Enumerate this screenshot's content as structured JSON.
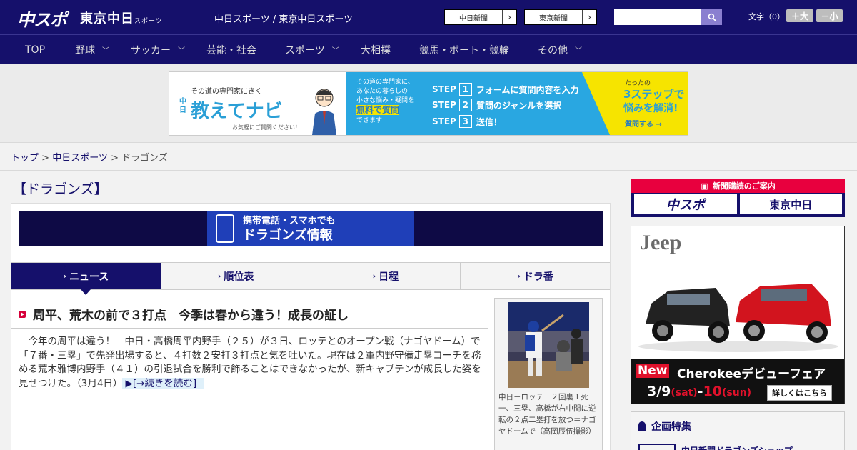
{
  "header": {
    "logo_main": "中スポ",
    "logo_sub": "東京中日",
    "logo_sub_small": "スポーツ",
    "site_title": "中日スポーツ / 東京中日スポーツ",
    "btn_chunichi": "中日新聞",
    "btn_tokyo": "東京新聞",
    "search_placeholder": "",
    "font_label": "文字（0）",
    "font_larger": "＋大",
    "font_smaller": "－小"
  },
  "nav": {
    "items": [
      {
        "label": "TOP",
        "has_menu": false
      },
      {
        "label": "野球",
        "has_menu": true
      },
      {
        "label": "サッカー",
        "has_menu": true
      },
      {
        "label": "芸能・社会",
        "has_menu": false
      },
      {
        "label": "スポーツ",
        "has_menu": true
      },
      {
        "label": "大相撲",
        "has_menu": false
      },
      {
        "label": "競馬・ボート・競輪",
        "has_menu": false
      },
      {
        "label": "その他",
        "has_menu": true
      }
    ]
  },
  "ad_banner": {
    "tagline": "その道の専門家にきく",
    "brand_prefix": "中日",
    "brand": "教えてナビ",
    "note": "お気軽にご質問ください！",
    "mid_text_1": "その道の専門家に、",
    "mid_text_2": "あなたの暮らしの",
    "mid_text_3": "小さな悩み・疑問を",
    "mid_highlight": "無料で質問",
    "mid_text_4": "できます",
    "steps": [
      {
        "num": "1",
        "text": "フォームに質問内容を入力"
      },
      {
        "num": "2",
        "text": "質問のジャンルを選択"
      },
      {
        "num": "3",
        "text": "送信！"
      }
    ],
    "step_label": "STEP",
    "right_small": "たったの",
    "right_big": "3ステップで",
    "right_big2": "悩みを解消!",
    "right_btn": "質問する"
  },
  "breadcrumb": {
    "home": "トップ",
    "sep1": " > ",
    "section": "中日スポーツ",
    "sep2": " > ",
    "current": "ドラゴンズ"
  },
  "page_title": "【ドラゴンズ】",
  "mobile_banner": {
    "line1": "携帯電話・スマホでも",
    "line2": "ドラゴンズ情報"
  },
  "tabs": [
    {
      "label": "ニュース",
      "active": true
    },
    {
      "label": "順位表",
      "active": false
    },
    {
      "label": "日程",
      "active": false
    },
    {
      "label": "ドラ番",
      "active": false
    }
  ],
  "article": {
    "headline": "周平、荒木の前で３打点　今季は春から違う！成長の証し",
    "body": "今年の周平は違う！　中日・高橋周平内野手（２５）が３日、ロッテとのオープン戦（ナゴヤドーム）で「７番・三塁」で先発出場すると、４打数２安打３打点と気を吐いた。現在は２軍内野守備走塁コーチを務める荒木雅博内野手（４１）の引退試合を勝利で飾ることはできなかったが、新キャプテンが成長した姿を見せつけた。（3月4日）",
    "read_more": "[→続きを読む]",
    "photo_caption": "中日－ロッテ　２回裏１死一、三塁、高橋が右中間に逆転の２点二塁打を放つ＝ナゴヤドームで（高岡辰伍撮影）"
  },
  "sidebar": {
    "subscribe_label": "新聞購読のご案内",
    "sub_logo_1": "中スポ",
    "sub_logo_2": "東京中日",
    "jeep_ad": {
      "brand": "Jeep",
      "new": "New",
      "title": "Cherokeeデビューフェア",
      "date1": "3/9",
      "date1_day": "(sat)",
      "dash": "-",
      "date2": "10",
      "date2_day": "(sun)",
      "cta": "詳しくはこちら"
    },
    "feature_title": "企画特集",
    "feature_item": "中日新聞ドラゴンズショップ"
  },
  "colors": {
    "brand_navy": "#15106b",
    "accent_red": "#e8003e",
    "ad_blue": "#29a7e1",
    "ad_yellow": "#f6e400"
  }
}
